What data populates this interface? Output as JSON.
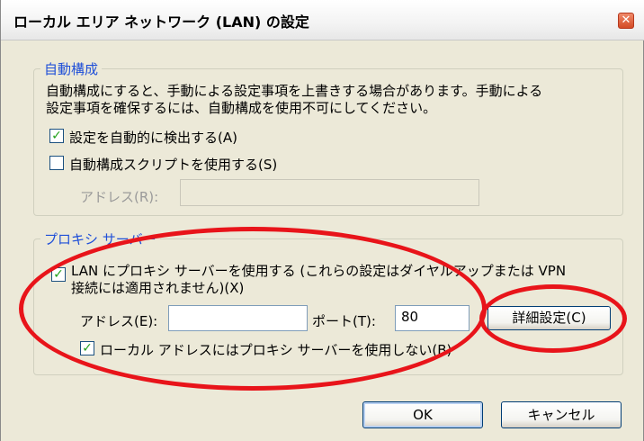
{
  "window": {
    "title": "ローカル エリア ネットワーク (LAN) の設定",
    "close_symbol": "✕"
  },
  "auto_config": {
    "legend": "自動構成",
    "description_line1": "自動構成にすると、手動による設定事項を上書きする場合があります。手動による",
    "description_line2": "設定事項を確保するには、自動構成を使用不可にしてください。",
    "auto_detect": {
      "label": "設定を自動的に検出する(A)",
      "checked": true
    },
    "use_script": {
      "label": "自動構成スクリプトを使用する(S)",
      "checked": false
    },
    "address_label": "アドレス(R):",
    "address_value": ""
  },
  "proxy": {
    "legend": "プロキシ サーバー",
    "use_proxy": {
      "label_line1": "LAN にプロキシ サーバーを使用する (これらの設定はダイヤルアップまたは VPN",
      "label_line2": "接続には適用されません)(X)",
      "checked": true
    },
    "address_label": "アドレス(E):",
    "address_value": "",
    "port_label": "ポート(T):",
    "port_value": "80",
    "advanced_label": "詳細設定(C)",
    "bypass_local": {
      "label": "ローカル アドレスにはプロキシ サーバーを使用しない(B)",
      "checked": true
    }
  },
  "buttons": {
    "ok": "OK",
    "cancel": "キャンセル"
  },
  "icons": {
    "check": "✓"
  },
  "colors": {
    "annotation": "#e8141a",
    "legend": "#1f4fd8",
    "dialog_bg": "#ECE9D8"
  }
}
